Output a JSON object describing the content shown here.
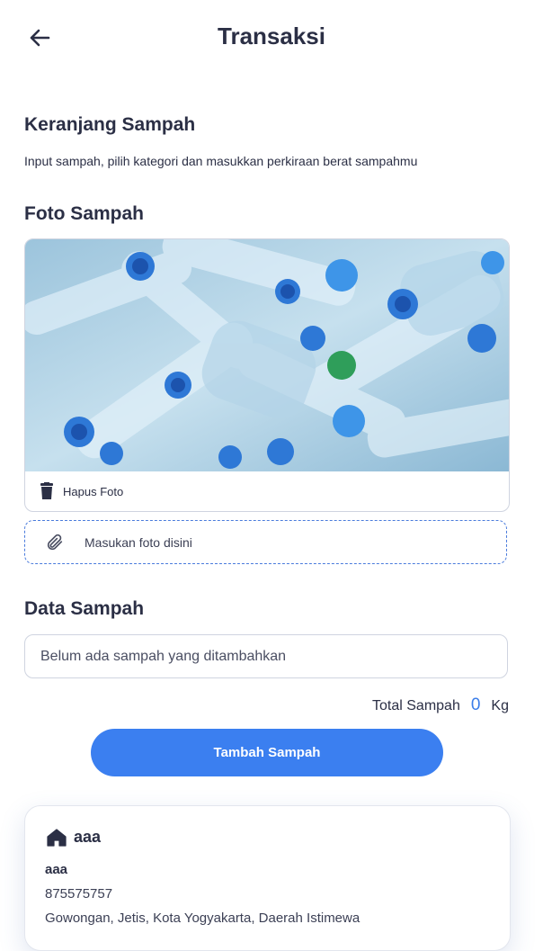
{
  "header": {
    "title": "Transaksi"
  },
  "cart": {
    "heading": "Keranjang Sampah",
    "subtitle": "Input sampah, pilih kategori dan masukkan perkiraan berat sampahmu"
  },
  "photo": {
    "heading": "Foto Sampah",
    "remove_label": "Hapus Foto",
    "upload_label": "Masukan foto disini"
  },
  "waste": {
    "heading": "Data Sampah",
    "empty_text": "Belum ada sampah yang ditambahkan",
    "total_label": "Total Sampah",
    "total_value": "0",
    "total_unit": "Kg",
    "add_button": "Tambah Sampah"
  },
  "address": {
    "label": "aaa",
    "name": "aaa",
    "phone": "875575757",
    "street": "Gowongan, Jetis, Kota Yogyakarta, Daerah Istimewa"
  },
  "colors": {
    "accent": "#3b7ff0",
    "text": "#2b2f45",
    "dashed_border": "#4a7bdc"
  },
  "icons": {
    "back": "arrow-left-icon",
    "trash": "trash-icon",
    "clip": "paperclip-icon",
    "home": "home-icon"
  }
}
